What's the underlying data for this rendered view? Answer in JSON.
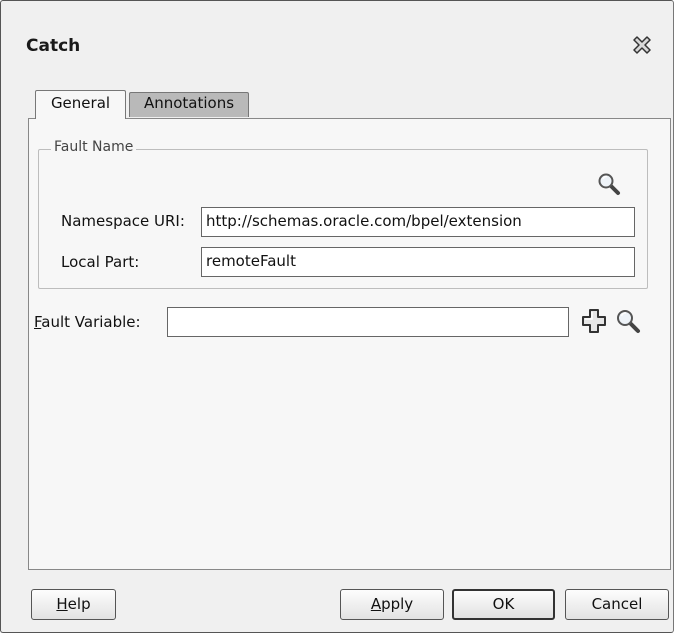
{
  "dialog": {
    "title": "Catch",
    "close_icon": "close-x-icon"
  },
  "tabs": [
    {
      "label": "General",
      "active": true
    },
    {
      "label": "Annotations",
      "active": false
    }
  ],
  "fault_name": {
    "legend": "Fault Name",
    "search_icon": "magnifier-icon",
    "namespace_label": "Namespace URI:",
    "namespace_value": "http://schemas.oracle.com/bpel/extension",
    "local_part_label": "Local Part:",
    "local_part_value": "remoteFault"
  },
  "fault_variable": {
    "label_mnemonic": "F",
    "label_rest": "ault Variable:",
    "value": "",
    "add_icon": "plus-icon",
    "search_icon": "magnifier-icon"
  },
  "buttons": {
    "help_mnemonic": "H",
    "help_rest": "elp",
    "apply_mnemonic": "A",
    "apply_rest": "pply",
    "ok": "OK",
    "cancel": "Cancel"
  }
}
